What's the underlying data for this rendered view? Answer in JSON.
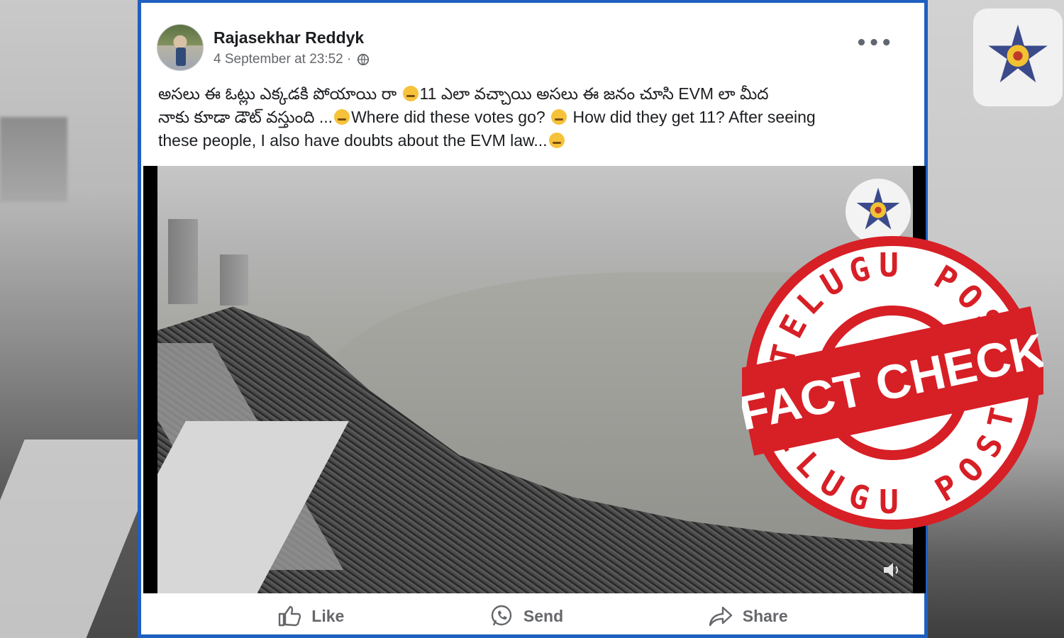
{
  "post": {
    "author": "Rajasekhar Reddyk",
    "timestamp": "4 September at 23:52 ·",
    "privacy_icon": "globe-icon",
    "more_label": "•••",
    "text_line1": "అసలు ఈ ఓట్లు ఎక్కడకి పోయాయి రా",
    "text_line1b": "11 ఎలా వచ్చాయి అసలు ఈ జనం చూసి EVM లా మీద",
    "text_line2a": "నాకు కూడా డౌట్ వస్తుంది ...",
    "text_line2b": "Where did these votes go?",
    "text_line2c": "How did they get 11? After seeing",
    "text_line3": "these people, I also have doubts about the EVM law..."
  },
  "video": {
    "volume_icon": "volume-icon"
  },
  "actions": {
    "like": "Like",
    "send": "Send",
    "share": "Share"
  },
  "stamp": {
    "top_text": "TELUGU POST",
    "main_text": "FACT CHECK",
    "bottom_text": "TELUGU POST",
    "color": "#d71f26"
  },
  "colors": {
    "card_border": "#1f5fbf",
    "text": "#1c1e21",
    "muted": "#65676b"
  }
}
